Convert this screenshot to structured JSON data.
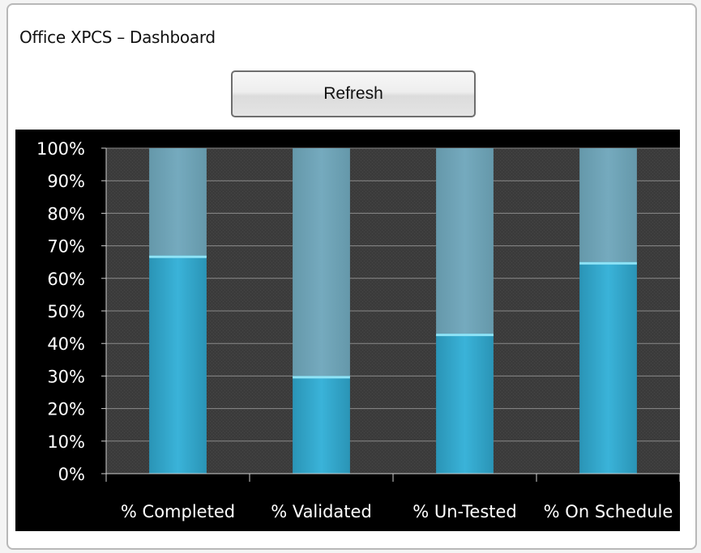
{
  "window": {
    "title": "Office XPCS – Dashboard"
  },
  "toolbar": {
    "refresh_label": "Refresh"
  },
  "chart_data": {
    "type": "bar",
    "stacked_to_100": true,
    "categories": [
      "% Completed",
      "% Validated",
      "% Un-Tested",
      "% On Schedule"
    ],
    "values": [
      67,
      30,
      43,
      65
    ],
    "ylim": [
      0,
      100
    ],
    "yticks": [
      "0%",
      "10%",
      "20%",
      "30%",
      "40%",
      "50%",
      "60%",
      "70%",
      "80%",
      "90%",
      "100%"
    ],
    "grid": true,
    "colors": {
      "fill": "#2fa9cf",
      "remainder": "#6fa4b8",
      "background": "#3a3a3a",
      "gridline": "#8a8a8a"
    }
  }
}
